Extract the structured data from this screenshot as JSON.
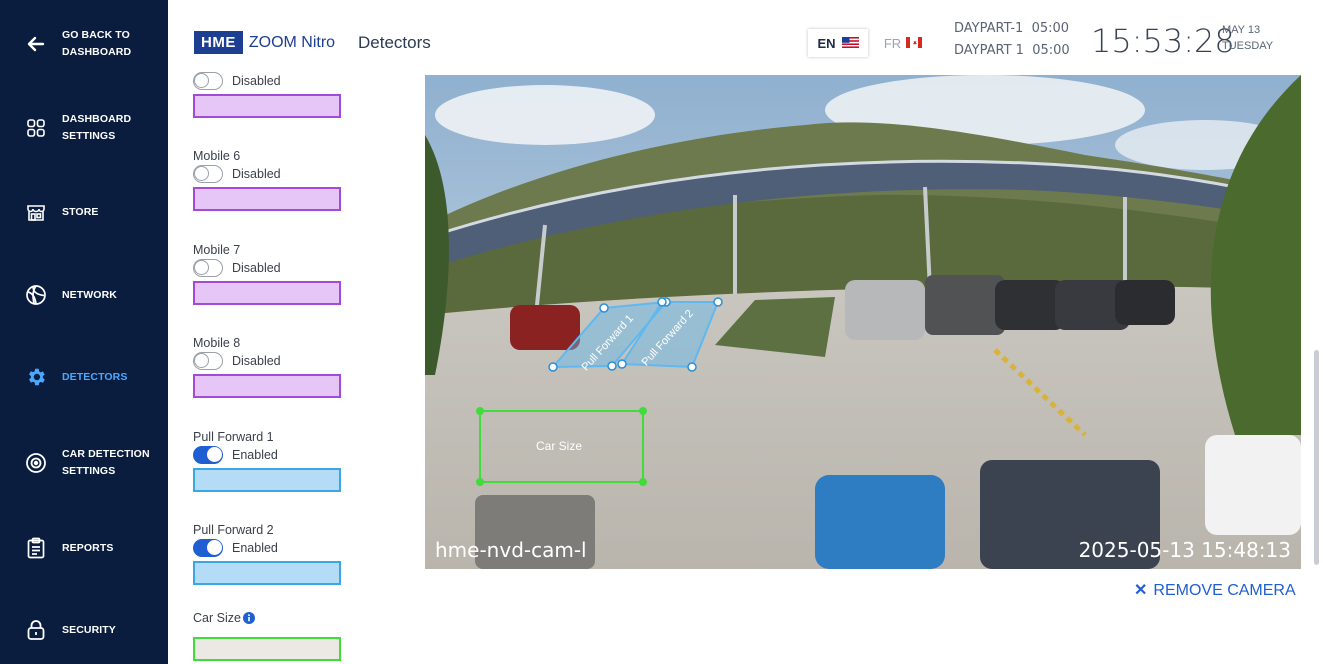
{
  "sidebar": {
    "items": [
      {
        "label": "GO BACK TO\nDASHBOARD",
        "icon": "arrow-left-icon",
        "active": false
      },
      {
        "label": "DASHBOARD\nSETTINGS",
        "icon": "dashboard-grid-icon",
        "active": false
      },
      {
        "label": "STORE",
        "icon": "store-icon",
        "active": false
      },
      {
        "label": "NETWORK",
        "icon": "network-globe-icon",
        "active": false
      },
      {
        "label": "DETECTORS",
        "icon": "gear-icon",
        "active": true
      },
      {
        "label": "CAR DETECTION\nSETTINGS",
        "icon": "car-detection-target-icon",
        "active": false
      },
      {
        "label": "REPORTS",
        "icon": "clipboard-icon",
        "active": false
      },
      {
        "label": "SECURITY",
        "icon": "lock-icon",
        "active": false
      }
    ]
  },
  "header": {
    "brand_box": "HME",
    "brand_name": "ZOOM Nitro",
    "title": "Detectors",
    "lang_en": "EN",
    "lang_fr": "FR",
    "daypart_1": "DAYPART-1  05:00",
    "daypart_2": "DAYPART 1  05:00",
    "clock": "15:53:28",
    "date_month": "MAY 13",
    "date_weekday": "TUESDAY"
  },
  "detectors": [
    {
      "name": "",
      "status": "Disabled",
      "enabled": false,
      "color": "#e6c6f7",
      "border": "#a24bd6"
    },
    {
      "name": "Mobile 6",
      "status": "Disabled",
      "enabled": false,
      "color": "#e6c6f7",
      "border": "#a24bd6"
    },
    {
      "name": "Mobile 7",
      "status": "Disabled",
      "enabled": false,
      "color": "#e6c6f7",
      "border": "#a24bd6"
    },
    {
      "name": "Mobile 8",
      "status": "Disabled",
      "enabled": false,
      "color": "#e6c6f7",
      "border": "#a24bd6"
    },
    {
      "name": "Pull Forward 1",
      "status": "Enabled",
      "enabled": true,
      "color": "#b4dcf7",
      "border": "#3aa6e6"
    },
    {
      "name": "Pull Forward 2",
      "status": "Enabled",
      "enabled": true,
      "color": "#b4dcf7",
      "border": "#3aa6e6"
    },
    {
      "name": "Car Size",
      "status": "",
      "enabled": null,
      "color": "#ece8e4",
      "border": "#3fdc3a"
    }
  ],
  "camera": {
    "cam_name": "hme-nvd-cam-l",
    "timestamp": "2025-05-13 15:48:13",
    "zones": {
      "pf1": "Pull Forward 1",
      "pf2": "Pull Forward 2",
      "car_size": "Car Size"
    }
  },
  "remove_camera": "REMOVE CAMERA",
  "colors": {
    "sidebar_bg": "#0b1d3f",
    "active_nav": "#4aa8ff",
    "accent_blue": "#1f5fd1",
    "zone_blue": "#5fb8ef",
    "zone_green": "#3fdc3a"
  }
}
